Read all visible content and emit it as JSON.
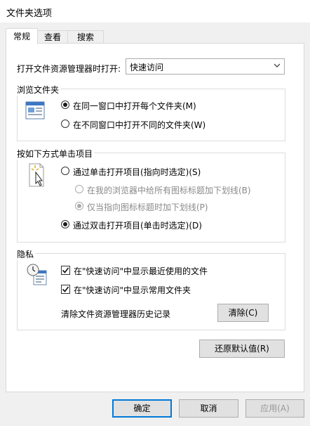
{
  "window": {
    "title": "文件夹选项"
  },
  "tabs": [
    {
      "label": "常规"
    },
    {
      "label": "查看"
    },
    {
      "label": "搜索"
    }
  ],
  "open_in": {
    "label": "打开文件资源管理器时打开:",
    "value": "快速访问"
  },
  "browse": {
    "title": "浏览文件夹",
    "options": [
      {
        "label": "在同一窗口中打开每个文件夹(M)",
        "checked": true
      },
      {
        "label": "在不同窗口中打开不同的文件夹(W)",
        "checked": false
      }
    ]
  },
  "click": {
    "title": "按如下方式单击项目",
    "single": "通过单击打开项目(指向时选定)(S)",
    "underline_all": "在我的浏览器中给所有图标标题加下划线(B)",
    "underline_point": "仅当指向图标标题时加下划线(P)",
    "double": "通过双击打开项目(单击时选定)(D)"
  },
  "privacy": {
    "title": "隐私",
    "recent": "在\"快速访问\"中显示最近使用的文件",
    "frequent": "在\"快速访问\"中显示常用文件夹",
    "clear_label": "清除文件资源管理器历史记录",
    "clear_button": "清除(C)"
  },
  "restore_button": "还原默认值(R)",
  "footer": {
    "ok": "确定",
    "cancel": "取消",
    "apply": "应用(A)"
  },
  "colors": {
    "accent": "#0078d7"
  }
}
